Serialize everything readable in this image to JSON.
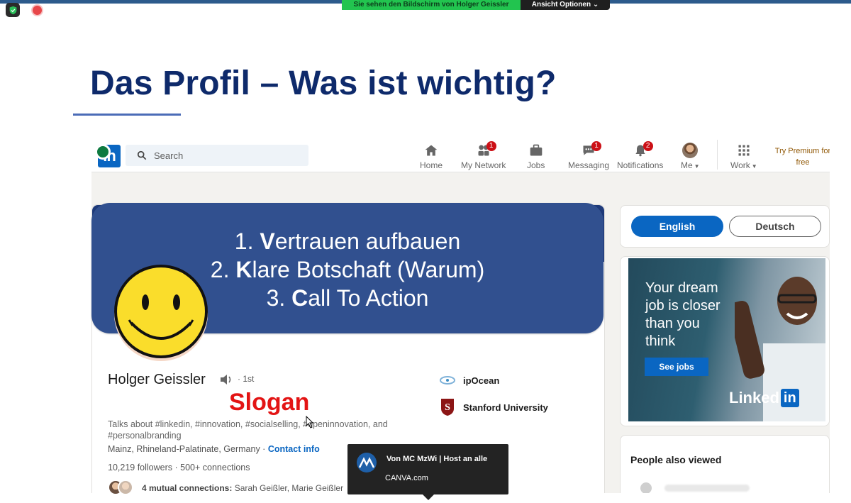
{
  "zoom": {
    "share_banner": "Sie sehen den Bildschirm von Holger Geissler",
    "view_options": "Ansicht Optionen",
    "colors": {
      "banner": "#22c44f",
      "bar": "#1f1f1f"
    }
  },
  "slide": {
    "title": "Das Profil – Was ist wichtig?",
    "goals": [
      {
        "num": "1. ",
        "initial": "V",
        "rest": "ertrauen aufbauen"
      },
      {
        "num": "2. ",
        "initial": "K",
        "rest": "lare Botschaft (Warum)"
      },
      {
        "num": "3. ",
        "initial": "C",
        "rest": "all To Action"
      }
    ],
    "slogan": "Slogan",
    "colors": {
      "title": "#0e2a6b",
      "box": "#31508f",
      "slogan": "#e31414"
    }
  },
  "linkedin": {
    "logo": "in",
    "search_placeholder": "Search",
    "nav": [
      {
        "label": "Home",
        "icon": "home-icon",
        "badge": ""
      },
      {
        "label": "My Network",
        "icon": "network-icon",
        "badge": "1"
      },
      {
        "label": "Jobs",
        "icon": "briefcase-icon",
        "badge": ""
      },
      {
        "label": "Messaging",
        "icon": "messaging-icon",
        "badge": "1"
      },
      {
        "label": "Notifications",
        "icon": "bell-icon",
        "badge": "2"
      },
      {
        "label": "Me",
        "icon": "avatar-icon",
        "badge": ""
      },
      {
        "label": "Work",
        "icon": "grid-icon",
        "badge": ""
      }
    ],
    "premium": "Try Premium for free",
    "profile": {
      "name": "Holger Geissler",
      "degree": "· 1st",
      "headline": "Talks about #linkedin, #innovation, #socialselling, #openinnovation, and #personalbranding",
      "location": "Mainz, Rhineland-Palatinate, Germany ·",
      "contact": "Contact info",
      "followers": "10,219 followers · 500+ connections",
      "mutual_count": "4 mutual connections:",
      "mutual_names": "Sarah Geißler, Marie Geißler",
      "companies": [
        "ipOcean",
        "Stanford University"
      ]
    },
    "lang": {
      "en": "English",
      "de": "Deutsch"
    },
    "ad": {
      "lines": [
        "Your dream",
        "job is closer",
        "than you",
        "think"
      ],
      "cta": "See jobs",
      "brand": "Linked",
      "brand_in": "in"
    },
    "people_also_viewed": "People also viewed",
    "colors": {
      "brand": "#0a66c2",
      "badge": "#cc1016"
    }
  },
  "host_popup": {
    "name": "Von MC MzWi | Host an alle",
    "message": "CANVA.com"
  }
}
